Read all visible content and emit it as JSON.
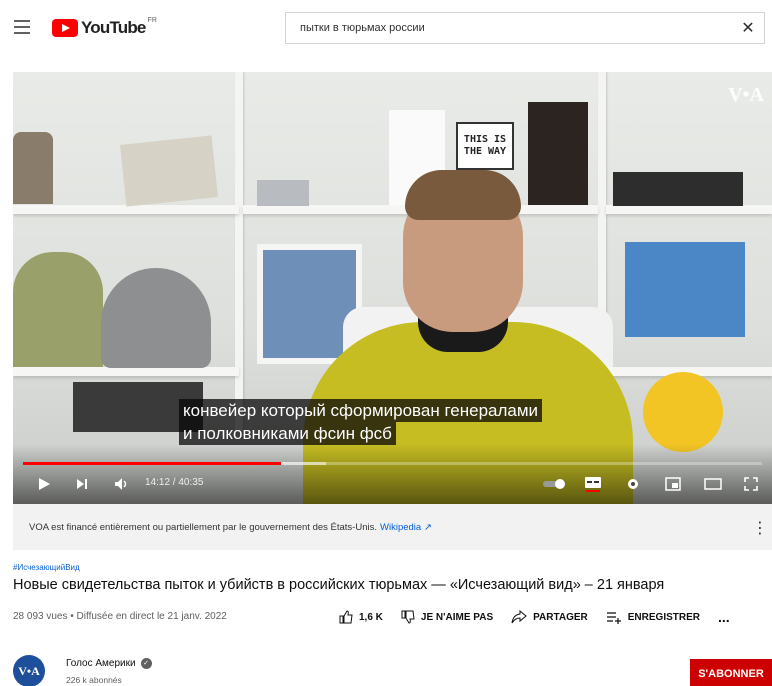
{
  "header": {
    "logo_text": "YouTube",
    "logo_region": "FR",
    "search_value": "пытки в тюрьмах россии",
    "icons": [
      "menu-icon",
      "clear-icon"
    ]
  },
  "video": {
    "watermark": "V•A",
    "sign_text": "THIS IS THE WAY",
    "subtitle_line1": "конвейер который сформирован генералами",
    "subtitle_line2": "и полковниками фсин фсб",
    "time_display": "14:12 / 40:35",
    "progress_fraction": 0.349,
    "buffer_fraction": 0.41,
    "icons": [
      "play-icon",
      "next-icon",
      "volume-icon",
      "autoplay-toggle-icon",
      "subtitles-icon",
      "settings-icon",
      "miniplayer-icon",
      "theater-icon",
      "fullscreen-icon"
    ]
  },
  "disclaimer": {
    "text": "VOA est financé entièrement ou partiellement par le gouvernement des États-Unis.",
    "link": "Wikipedia"
  },
  "meta": {
    "hashtag": "#ИсчезающийВид",
    "title": "Новые свидетельства пыток и убийств в российских тюрьмах — «Исчезающий вид» – 21 января",
    "views": "28 093 vues • Diffusée en direct le 21 janv. 2022",
    "likes": "1,6 K",
    "dislike_label": "JE N'AIME PAS",
    "share_label": "PARTAGER",
    "save_label": "ENREGISTRER",
    "more_label": "..."
  },
  "channel": {
    "avatar_text": "V•A",
    "name": "Голос Америки",
    "subscribers": "226 k abonnés",
    "subscribe_label": "S'ABONNER"
  },
  "colors": {
    "accent_red": "#ff0000",
    "subscribe_red": "#cc0000",
    "link_blue": "#065fd4",
    "hoodie": "#c5bd22"
  }
}
